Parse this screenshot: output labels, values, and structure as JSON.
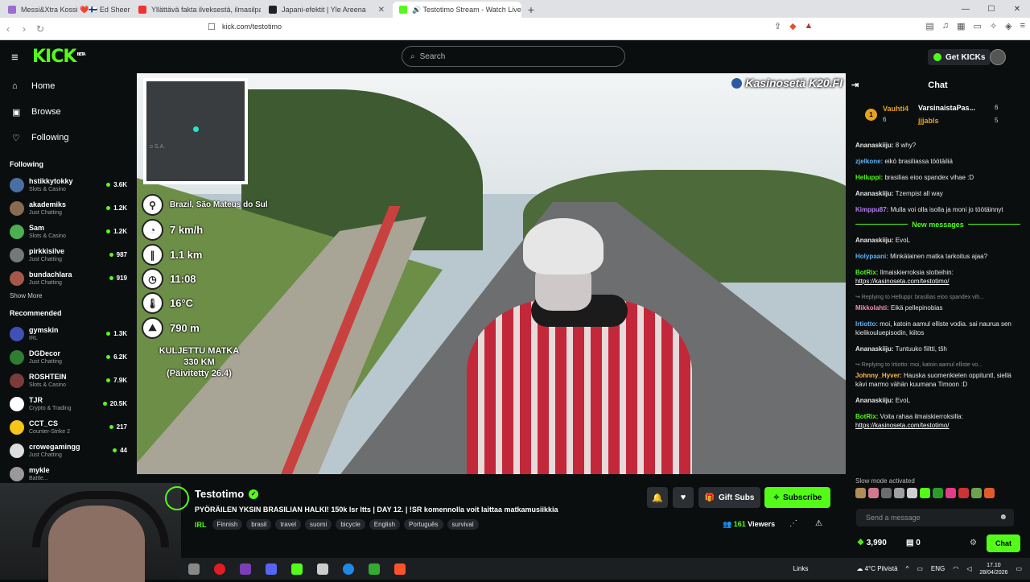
{
  "browser": {
    "tabs": [
      {
        "title": "Messi&Xtra Kossi ❤️🇫🇮 Ed Sheeran",
        "color": "#9b6cd1"
      },
      {
        "title": "Yllättävä fakta ilveksestä, ilmasilpari ...",
        "color": "#e33"
      },
      {
        "title": "Japani-efektit | Yle Areena",
        "color": "#222"
      },
      {
        "title": "🔊 Testotimo Stream - Watch Live",
        "color": "#53fc18"
      }
    ],
    "url": "kick.com/testotimo"
  },
  "header": {
    "logo": "KICK",
    "logo_sup": "BETA",
    "search_placeholder": "Search",
    "get_kicks": "Get KICKs"
  },
  "sidebar": {
    "nav": [
      {
        "label": "Home",
        "icon": "home-icon",
        "glyph": "⌂"
      },
      {
        "label": "Browse",
        "icon": "browse-icon",
        "glyph": "▣"
      },
      {
        "label": "Following",
        "icon": "heart-icon",
        "glyph": "♡"
      }
    ],
    "following_title": "Following",
    "following": [
      {
        "name": "hstikkytokky",
        "category": "Slots & Casino",
        "viewers": "3.6K",
        "color": "#4a6fa5"
      },
      {
        "name": "akademiks",
        "category": "Just Chatting",
        "viewers": "1.2K",
        "color": "#8a6b4f"
      },
      {
        "name": "Sam",
        "category": "Slots & Casino",
        "viewers": "1.2K",
        "color": "#4caf50"
      },
      {
        "name": "pirkkisilve",
        "category": "Just Chatting",
        "viewers": "987",
        "color": "#777"
      },
      {
        "name": "bundachlara",
        "category": "Just Chatting",
        "viewers": "919",
        "color": "#a5584a"
      }
    ],
    "show_more": "Show More",
    "recommended_title": "Recommended",
    "recommended": [
      {
        "name": "gymskin",
        "category": "IRL",
        "viewers": "1.3K",
        "color": "#3f51b5"
      },
      {
        "name": "DGDecor",
        "category": "Just Chatting",
        "viewers": "6.2K",
        "color": "#2e7d32"
      },
      {
        "name": "ROSHTEIN",
        "category": "Slots & Casino",
        "viewers": "7.9K",
        "color": "#7b3b3b"
      },
      {
        "name": "TJR",
        "category": "Crypto & Trading",
        "viewers": "20.5K",
        "color": "#fff"
      },
      {
        "name": "CCT_CS",
        "category": "Counter-Strike 2",
        "viewers": "217",
        "color": "#f5c518"
      },
      {
        "name": "crowegamingg",
        "category": "Just Chatting",
        "viewers": "44",
        "color": "#ddd"
      },
      {
        "name": "mykle",
        "category": "Battle...",
        "viewers": "",
        "color": "#999"
      }
    ]
  },
  "video": {
    "minimap_label": "o S.A.",
    "location": "Brazil, São Mateus do Sul",
    "speed": "7 km/h",
    "distance": "1.1 km",
    "time": "11:08",
    "temperature": "16°C",
    "altitude": "790 m",
    "total_label": "KULJETTU MATKA",
    "total_value": "330 KM",
    "total_updated": "(Päivitetty 26.4)",
    "sponsor": "Kasinosetä K20.FI"
  },
  "stream": {
    "name": "Testotimo",
    "title": "PYÖRÄILEN YKSIN BRASILIAN HALKI! 150k lsr ltts | DAY 12. | !SR komennolla voit laittaa matkamusiikkia",
    "category": "IRL",
    "tags": [
      "Finnish",
      "brasil",
      "travel",
      "suomi",
      "bicycle",
      "English",
      "Português",
      "survival"
    ],
    "gift_subs": "Gift Subs",
    "subscribe": "Subscribe",
    "viewers_count": "161",
    "viewers_label": "Viewers"
  },
  "chat": {
    "title": "Chat",
    "pinned": {
      "rank": "1",
      "top_user": "Vauhti4",
      "top_value": "6",
      "user2": "VarsinaistaPas...",
      "user2_value": "6",
      "user3": "jjjabls",
      "user3_value": "5"
    },
    "messages_before": [
      {
        "user": "Ananaskiiju",
        "color": "#e8e8e8",
        "text": "8 why?"
      },
      {
        "user": "zjelkone",
        "color": "#5fb3f5",
        "text": "eikö brasiliassa töötäiliä"
      },
      {
        "user": "Helluppi",
        "color": "#53fc18",
        "text": "brasilias eioo spandex vihae :D"
      },
      {
        "user": "Ananaskiiju",
        "color": "#e8e8e8",
        "text": "Tzempist all way"
      },
      {
        "user": "Kimppu87",
        "color": "#b77cf7",
        "text": "Mulla voi olla isolla ja moni jo töötäinnyt"
      }
    ],
    "new_messages": "New messages",
    "messages_after": [
      {
        "user": "Ananaskiiju",
        "color": "#e8e8e8",
        "text": "EvoL"
      },
      {
        "user": "Holypaani",
        "color": "#5fb3f5",
        "text": "Minkälainen matka tarkoitus ajaa?"
      },
      {
        "user": "BotRix",
        "color": "#53fc18",
        "text": "Ilmaiskierroksia slotteihin:",
        "link": "https://kasinoseta.com/testotimo/"
      },
      {
        "reply": "Replying to Helluppi: brasilias eioo spandex vih..."
      },
      {
        "user": "Mikkolahti",
        "color": "#f48fb1",
        "text": "Eikä pellepinobias"
      },
      {
        "user": "Irtiotto",
        "color": "#5fb3f5",
        "text": "moi, katoin aamul elliste vodia. sai naurua sen kielikouluepisodin, kiitos"
      },
      {
        "user": "Ananaskiiju",
        "color": "#e8e8e8",
        "text": "Tuntuuko fiiltti, tšh"
      },
      {
        "reply": "Replying to Irtiotto: moi, katoin aamul elliste vo..."
      },
      {
        "user": "Johnny_Hyver",
        "color": "#ffb74d",
        "text": "Hauska suomenkielen oppituntl, siellä kävi marmo vähän kuumana Timoon :D"
      },
      {
        "user": "Ananaskiiju",
        "color": "#e8e8e8",
        "text": "EvoL"
      },
      {
        "user": "BotRix",
        "color": "#53fc18",
        "text": "Voita rahaa ilmaiskierroksilla:",
        "link": "https://kasinoseta.com/testotimo/"
      }
    ],
    "slow_mode": "Slow mode activated",
    "input_placeholder": "Send a message",
    "points": "3,990",
    "count": "0",
    "send_label": "Chat"
  },
  "taskbar": {
    "links": "Links",
    "weather": "4°C Pilvistä",
    "lang": "ENG",
    "time": "17.10",
    "date": "28/04/2026"
  }
}
